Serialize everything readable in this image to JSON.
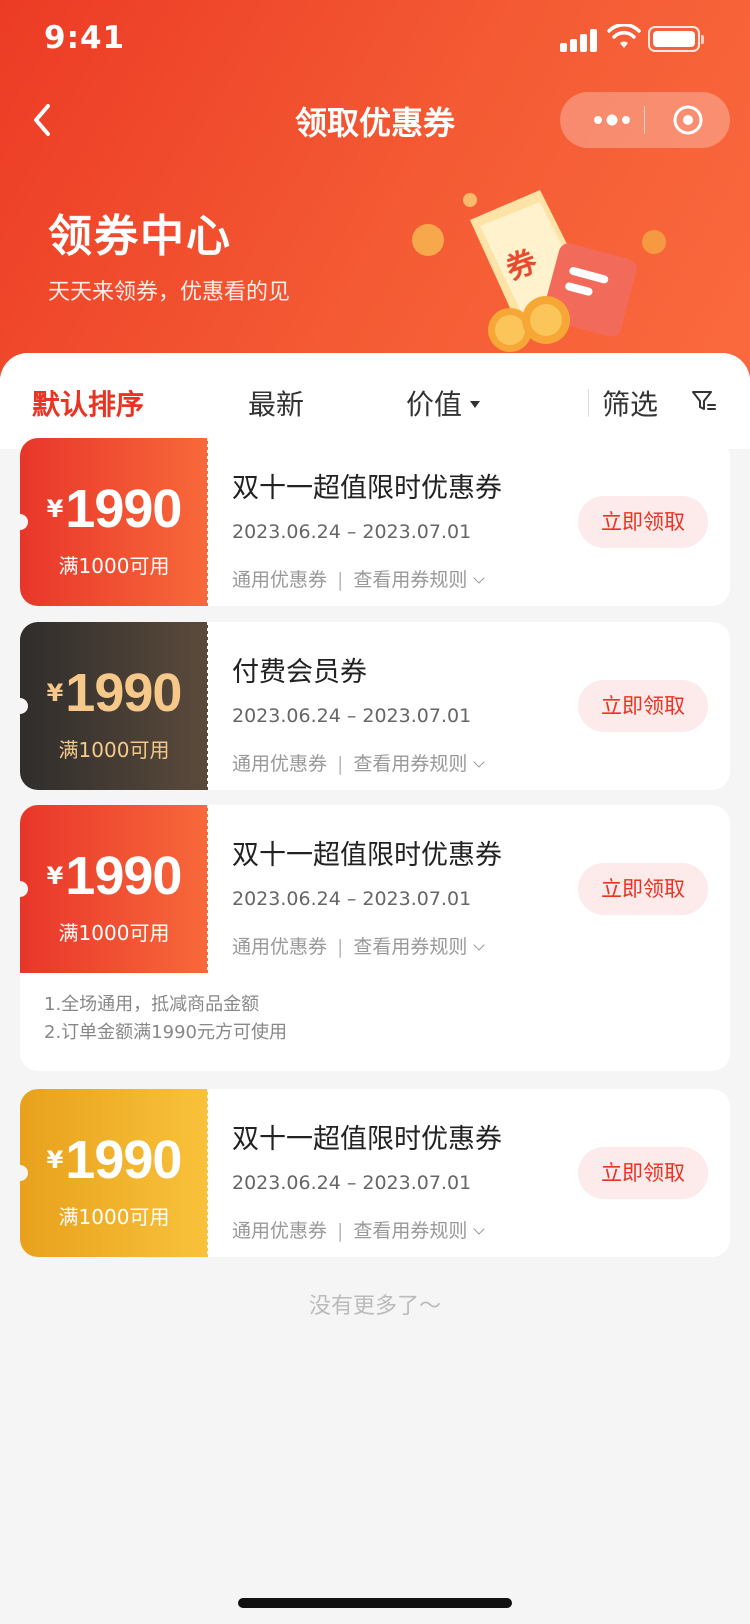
{
  "status": {
    "time": "9:41"
  },
  "nav": {
    "title": "领取优惠券"
  },
  "hero": {
    "title": "领券中心",
    "subtitle": "天天来领券，优惠看的见",
    "illustration_text": "券"
  },
  "tabs": [
    {
      "label": "默认排序",
      "active": true
    },
    {
      "label": "最新",
      "active": false
    },
    {
      "label": "价值",
      "active": false
    },
    {
      "label": "筛选",
      "active": false
    }
  ],
  "coupons": [
    {
      "currency": "¥",
      "amount": "1990",
      "condition": "满1000可用",
      "name": "双十一超值限时优惠券",
      "date": "2023.06.24 – 2023.07.01",
      "type": "通用优惠券",
      "rules_link": "查看用券规则",
      "claim": "立即领取",
      "theme": "red"
    },
    {
      "currency": "¥",
      "amount": "1990",
      "condition": "满1000可用",
      "name": "付费会员券",
      "date": "2023.06.24 – 2023.07.01",
      "type": "通用优惠券",
      "rules_link": "查看用券规则",
      "claim": "立即领取",
      "theme": "dark"
    },
    {
      "currency": "¥",
      "amount": "1990",
      "condition": "满1000可用",
      "name": "双十一超值限时优惠券",
      "date": "2023.06.24 – 2023.07.01",
      "type": "通用优惠券",
      "rules_link": "查看用券规则",
      "claim": "立即领取",
      "theme": "red",
      "rules": [
        "1.全场通用，抵减商品金额",
        "2.订单金额满1990元方可使用"
      ]
    },
    {
      "currency": "¥",
      "amount": "1990",
      "condition": "满1000可用",
      "name": "双十一超值限时优惠券",
      "date": "2023.06.24 – 2023.07.01",
      "type": "通用优惠券",
      "rules_link": "查看用券规则",
      "claim": "立即领取",
      "theme": "gold"
    }
  ],
  "footer": {
    "no_more": "没有更多了～"
  },
  "colors": {
    "accent": "#e93323",
    "header_start": "#ec3b25",
    "header_end": "#fb6a3f",
    "member": "#f6c98a",
    "gold": "#f9c23a"
  },
  "icons": [
    "back-icon",
    "more-dots-icon",
    "close-target-icon",
    "filter-icon",
    "chevron-down-icon",
    "signal-icon",
    "wifi-icon",
    "battery-icon"
  ]
}
